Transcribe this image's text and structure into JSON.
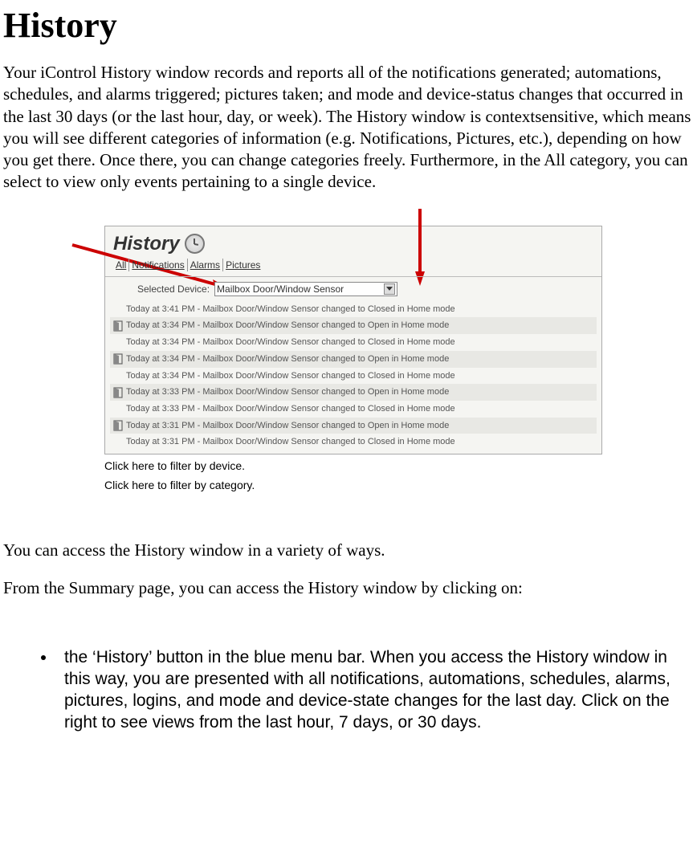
{
  "title": "History",
  "intro": "Your iControl History window records and reports all of the notifications generated; automations, schedules, and alarms triggered; pictures taken; and mode and device-status changes that occurred in the last 30 days (or the last hour, day, or week). The History window is contextsensitive, which means you will see different categories of information (e.g. Notifications, Pictures, etc.), depending on how you get there. Once there, you can change categories freely. Furthermore, in the All category, you can select to view only events pertaining to a single device.",
  "panel": {
    "title": "History"
  },
  "tabs": [
    "All",
    "Notifications",
    "Alarms",
    "Pictures"
  ],
  "device_selector": {
    "label": "Selected Device:",
    "value": "Mailbox Door/Window Sensor"
  },
  "history_rows": [
    {
      "icon": false,
      "text": "Today at 3:41 PM - Mailbox Door/Window Sensor changed to Closed in Home mode"
    },
    {
      "icon": true,
      "text": "Today at 3:34 PM - Mailbox Door/Window Sensor changed to Open in Home mode"
    },
    {
      "icon": false,
      "text": "Today at 3:34 PM - Mailbox Door/Window Sensor changed to Closed in Home mode"
    },
    {
      "icon": true,
      "text": "Today at 3:34 PM - Mailbox Door/Window Sensor changed to Open in Home mode"
    },
    {
      "icon": false,
      "text": "Today at 3:34 PM - Mailbox Door/Window Sensor changed to Closed in Home mode"
    },
    {
      "icon": true,
      "text": "Today at 3:33 PM - Mailbox Door/Window Sensor changed to Open in Home mode"
    },
    {
      "icon": false,
      "text": "Today at 3:33 PM - Mailbox Door/Window Sensor changed to Closed in Home mode"
    },
    {
      "icon": true,
      "text": "Today at 3:31 PM - Mailbox Door/Window Sensor changed to Open in Home mode"
    },
    {
      "icon": false,
      "text": "Today at 3:31 PM - Mailbox Door/Window Sensor changed to Closed in Home mode"
    }
  ],
  "captions": {
    "device": "Click here to filter by device.",
    "category": "Click here to filter by category."
  },
  "body1": "You can access the History window in a variety of ways.",
  "body2": "From the Summary page, you can access the History window by clicking on:",
  "bullet1": "the ‘History’ button in the blue menu bar. When you access the History window in this way, you are presented with all notifications, automations, schedules, alarms, pictures, logins, and mode and device-state changes for the last day. Click on the right to see views from the last hour, 7 days, or 30 days."
}
